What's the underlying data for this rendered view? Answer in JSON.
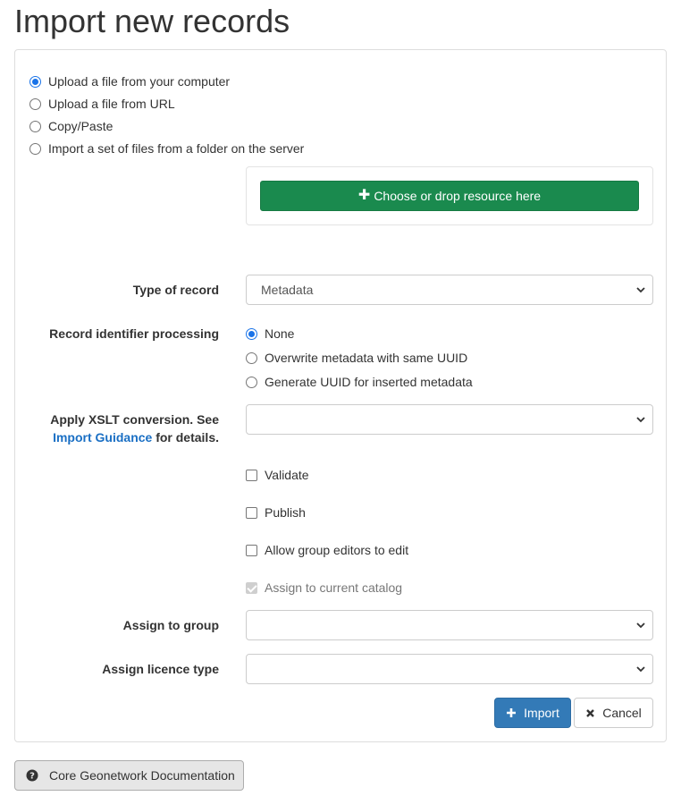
{
  "page": {
    "title": "Import new records"
  },
  "import_mode": {
    "options": [
      {
        "label": "Upload a file from your computer",
        "checked": true
      },
      {
        "label": "Upload a file from URL",
        "checked": false
      },
      {
        "label": "Copy/Paste",
        "checked": false
      },
      {
        "label": "Import a set of files from a folder on the server",
        "checked": false
      }
    ]
  },
  "upload": {
    "button_label": "Choose or drop resource here",
    "icon": "plus-icon"
  },
  "form": {
    "type_of_record": {
      "label": "Type of record",
      "value": "Metadata"
    },
    "identifier_processing": {
      "label": "Record identifier processing",
      "options": [
        {
          "label": "None",
          "checked": true
        },
        {
          "label": "Overwrite metadata with same UUID",
          "checked": false
        },
        {
          "label": "Generate UUID for inserted metadata",
          "checked": false
        }
      ]
    },
    "xslt": {
      "label_prefix": "Apply XSLT conversion. See",
      "link": "Import Guidance",
      "label_suffix": "for details.",
      "value": ""
    },
    "checkboxes": [
      {
        "label": "Validate",
        "checked": false,
        "disabled": false
      },
      {
        "label": "Publish",
        "checked": false,
        "disabled": false
      },
      {
        "label": "Allow group editors to edit",
        "checked": false,
        "disabled": false
      },
      {
        "label": "Assign to current catalog",
        "checked": true,
        "disabled": true
      }
    ],
    "group": {
      "label": "Assign to group",
      "value": ""
    },
    "licence": {
      "label": "Assign licence type",
      "value": ""
    }
  },
  "actions": {
    "import_label": "Import",
    "cancel_label": "Cancel"
  },
  "footer": {
    "doc_label": "Core Geonetwork Documentation"
  },
  "colors": {
    "success": "#1a8a4e",
    "primary": "#337ab7",
    "link": "#1a6fc4",
    "radio_accent": "#1a73e8"
  }
}
